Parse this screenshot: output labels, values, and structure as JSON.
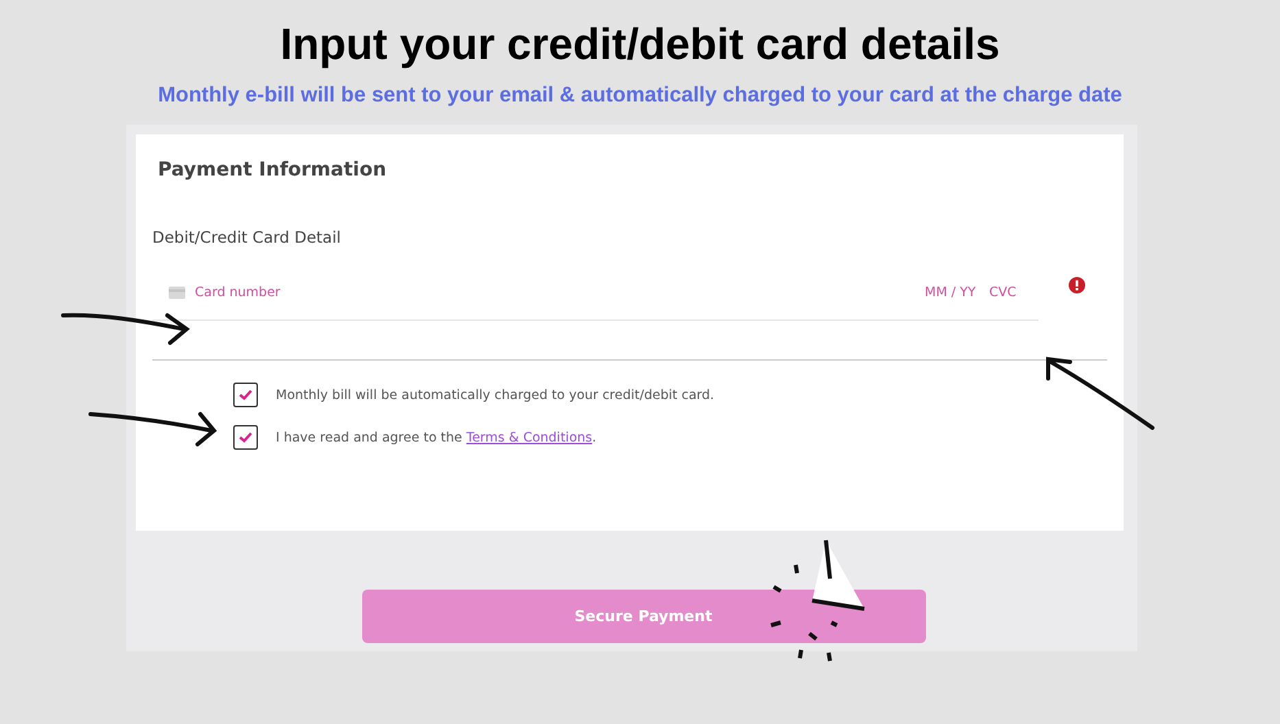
{
  "heading": "Input your credit/debit card details",
  "subheading": "Monthly e-bill will be sent to your email & automatically charged to your card at the charge date",
  "form": {
    "title": "Payment Information",
    "section_label": "Debit/Credit Card Detail",
    "card_field": {
      "placeholder": "Card number",
      "expiry_placeholder": "MM / YY",
      "cvc_placeholder": "CVC",
      "error": true
    },
    "checkboxes": [
      {
        "label": "Monthly bill will be automatically charged to your credit/debit card.",
        "checked": true
      },
      {
        "label": "I have read and agree to the ",
        "link": "Terms & Conditions",
        "suffix": ".",
        "checked": true
      }
    ],
    "submit": "Secure Payment"
  }
}
